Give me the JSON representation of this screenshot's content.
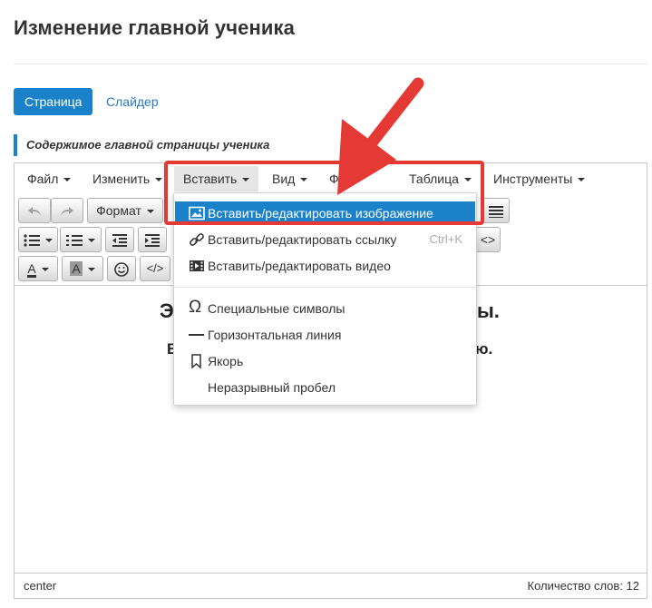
{
  "page_title": "Изменение главной ученика",
  "tabs": [
    {
      "label": "Страница",
      "active": true
    },
    {
      "label": "Слайдер",
      "active": false
    }
  ],
  "section_label": "Содержимое главной страницы ученика",
  "menubar": {
    "items": [
      {
        "label": "Файл"
      },
      {
        "label": "Изменить"
      },
      {
        "label": "Вставить"
      },
      {
        "label": "Вид"
      },
      {
        "label": "Фо"
      },
      {
        "label": "Таблица"
      },
      {
        "label": "Инструменты"
      }
    ]
  },
  "toolbar": {
    "format_label": "Формат",
    "code_label": "</>",
    "source_label": "<>",
    "text_color_label": "A",
    "bg_color_label": "A"
  },
  "content": {
    "heading_fragment_1": "Э",
    "heading_fragment_2": "ы.",
    "line_fragment_1": "В",
    "line_fragment_2": "ю."
  },
  "dropdown": {
    "items": [
      {
        "label": "Вставить/редактировать изображение",
        "icon": "image-icon",
        "active": true
      },
      {
        "label": "Вставить/редактировать ссылку",
        "icon": "link-icon",
        "shortcut": "Ctrl+K"
      },
      {
        "label": "Вставить/редактировать видео",
        "icon": "video-icon"
      },
      {
        "label": "Специальные символы",
        "icon": "omega-icon"
      },
      {
        "label": "Горизонтальная линия",
        "icon": "horizontal-line-icon"
      },
      {
        "label": "Якорь",
        "icon": "bookmark-icon"
      },
      {
        "label": "Неразрывный пробел",
        "icon": ""
      }
    ]
  },
  "statusbar": {
    "path": "center",
    "word_count": "Количество слов: 12"
  },
  "colors": {
    "accent": "#1b82c9",
    "annotation": "#e53935"
  }
}
